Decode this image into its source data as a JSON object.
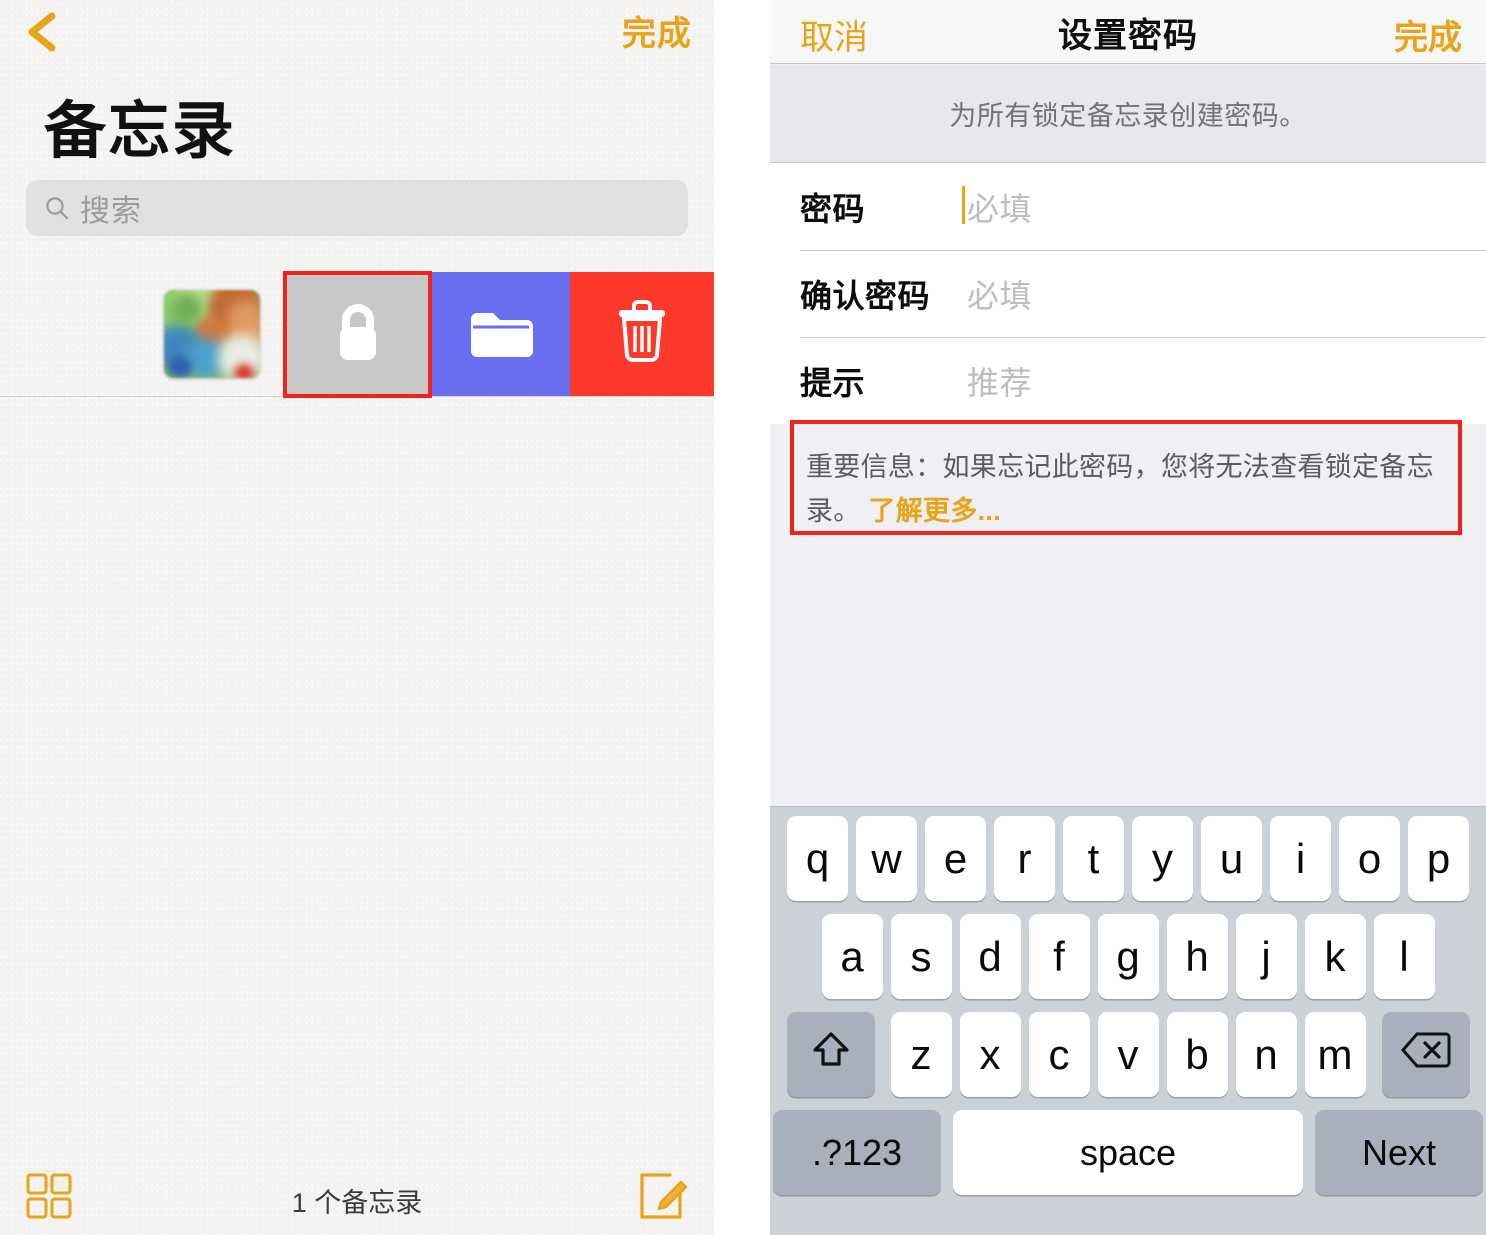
{
  "colors": {
    "accent_gold": "#e8a317",
    "highlight_red": "#f1211b",
    "lock_action_bg": "#c7c7c7",
    "folder_action_bg": "#6a6ef0",
    "trash_action_bg": "#fc392a",
    "keyboard_bg": "#ccd0d7"
  },
  "notes_panel": {
    "back_icon": "chevron-left-icon",
    "done_label": "完成",
    "title": "备忘录",
    "search": {
      "icon": "search-icon",
      "placeholder": "搜索"
    },
    "note_row": {
      "thumbnail": "note-thumbnail",
      "swipe_actions": [
        {
          "name": "lock",
          "icon": "lock-icon",
          "highlighted": true
        },
        {
          "name": "move",
          "icon": "folder-icon",
          "highlighted": false
        },
        {
          "name": "delete",
          "icon": "trash-icon",
          "highlighted": false
        }
      ]
    },
    "toolbar": {
      "grid_icon": "grid-view-icon",
      "count_label": "1 个备忘录",
      "compose_icon": "compose-icon"
    }
  },
  "password_panel": {
    "nav": {
      "cancel_label": "取消",
      "title": "设置密码",
      "done_label": "完成"
    },
    "description": "为所有锁定备忘录创建密码。",
    "fields": [
      {
        "label": "密码",
        "value": "",
        "placeholder": "必填",
        "focused": true
      },
      {
        "label": "确认密码",
        "value": "",
        "placeholder": "必填",
        "focused": false
      },
      {
        "label": "提示",
        "value": "",
        "placeholder": "推荐",
        "focused": false
      }
    ],
    "warning": {
      "text": "重要信息：如果忘记此密码，您将无法查看锁定备忘录。",
      "link_label": "了解更多...",
      "highlighted": true
    },
    "keyboard": {
      "row1": [
        "q",
        "w",
        "e",
        "r",
        "t",
        "y",
        "u",
        "i",
        "o",
        "p"
      ],
      "row2": [
        "a",
        "s",
        "d",
        "f",
        "g",
        "h",
        "j",
        "k",
        "l"
      ],
      "row3": [
        "z",
        "x",
        "c",
        "v",
        "b",
        "n",
        "m"
      ],
      "shift_icon": "shift-icon",
      "backspace_icon": "backspace-icon",
      "numbers_label": ".?123",
      "space_label": "space",
      "return_label": "Next"
    }
  }
}
